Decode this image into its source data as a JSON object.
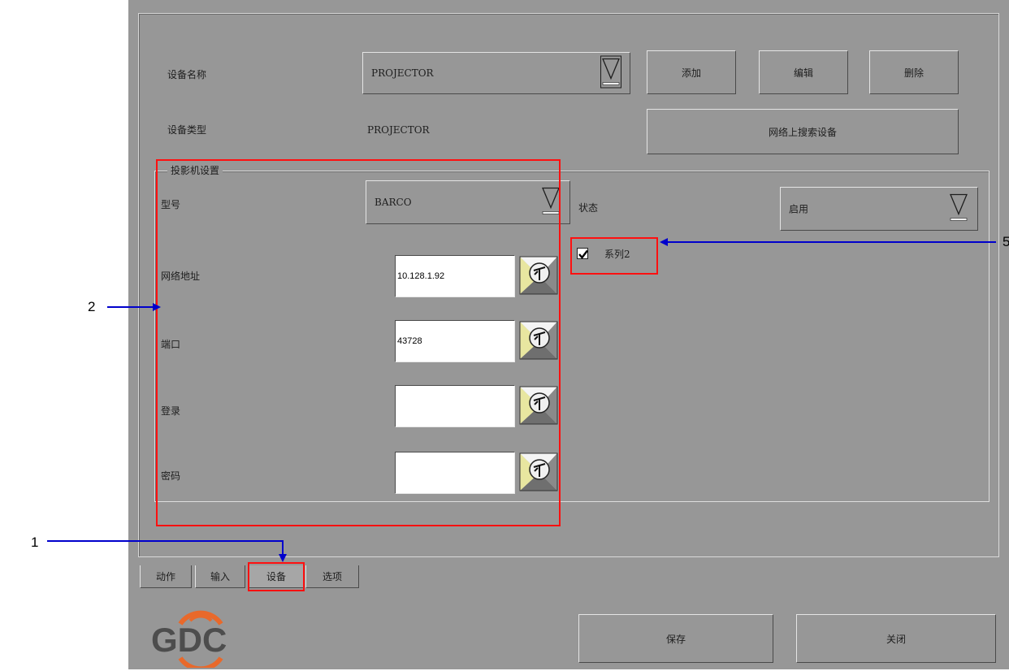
{
  "device": {
    "name_label": "设备名称",
    "name_value": "PROJECTOR",
    "add_label": "添加",
    "edit_label": "编辑",
    "delete_label": "删除",
    "type_label": "设备类型",
    "type_value": "PROJECTOR",
    "search_label": "网络上搜索设备"
  },
  "projector_settings": {
    "title": "投影机设置",
    "model_label": "型号",
    "model_value": "BARCO",
    "status_label": "状态",
    "status_value": "启用",
    "series_label": "系列2",
    "series_checked": true,
    "ip_label": "网络地址",
    "ip_value": "10.128.1.92",
    "port_label": "端口",
    "port_value": "43728",
    "login_label": "登录",
    "login_value": "",
    "password_label": "密码",
    "password_value": ""
  },
  "tabs": [
    "动作",
    "输入",
    "设备",
    "选项"
  ],
  "active_tab": "设备",
  "footer": {
    "logo_text": "GDC",
    "save_label": "保存",
    "close_label": "关闭"
  },
  "callouts": [
    "1",
    "2",
    "5"
  ],
  "colors": {
    "window_bg": "#979797",
    "highlight": "#ff1010",
    "arrow": "#0000cc",
    "logo_orange": "#e8692b",
    "logo_gray": "#4d4d4d"
  },
  "icons": [
    "dropdown-arrow-icon",
    "keyboard-icon",
    "checkmark-icon",
    "gdc-logo"
  ]
}
